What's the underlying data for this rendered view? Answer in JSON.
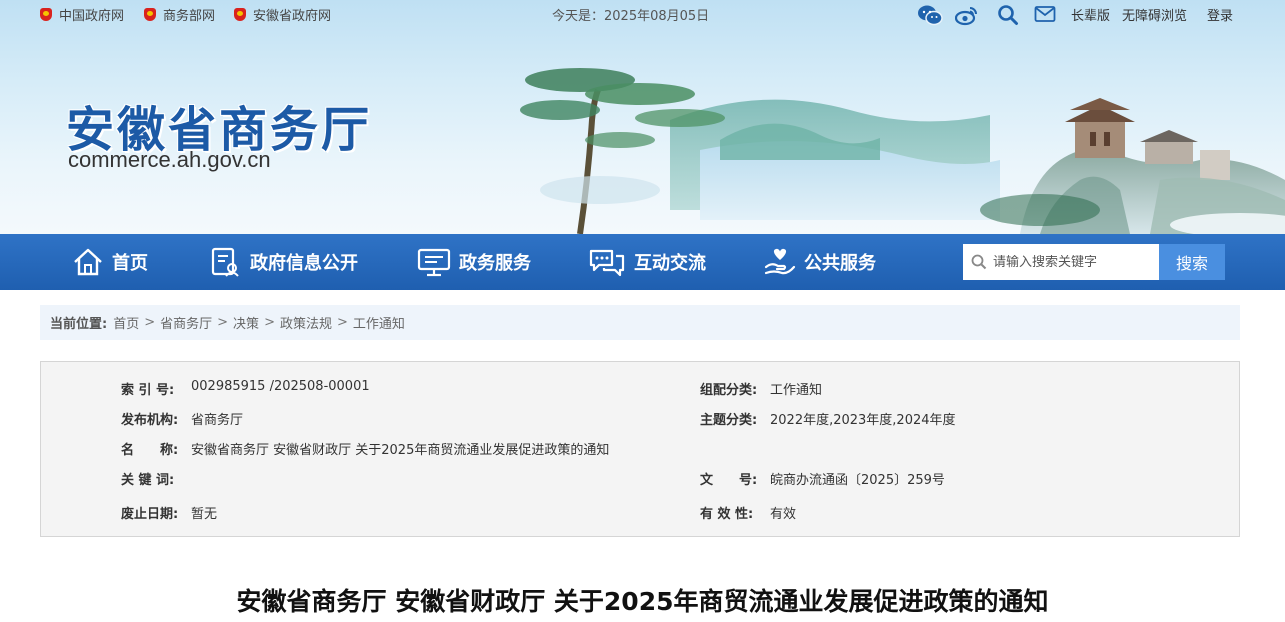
{
  "topbar": {
    "links": [
      "中国政府网",
      "商务部网",
      "安徽省政府网"
    ],
    "date": "今天是：2025年08月05日",
    "icons": [
      "wechat-icon",
      "weibo-icon",
      "search-icon",
      "mail-icon"
    ],
    "elder_mode": "长辈版",
    "accessibility": "无障碍浏览",
    "login": "登录"
  },
  "header": {
    "title": "安徽省商务厅",
    "domain": "commerce.ah.gov.cn"
  },
  "nav": {
    "items": [
      {
        "label": "首页",
        "icon": "home-icon"
      },
      {
        "label": "政府信息公开",
        "icon": "document-icon"
      },
      {
        "label": "政务服务",
        "icon": "monitor-icon"
      },
      {
        "label": "互动交流",
        "icon": "chat-icon"
      },
      {
        "label": "公共服务",
        "icon": "hand-heart-icon"
      }
    ],
    "search_placeholder": "请输入搜索关键字",
    "search_button": "搜索"
  },
  "breadcrumb": {
    "label": "当前位置:",
    "items": [
      "首页",
      "省商务厅",
      "决策",
      "政策法规",
      "工作通知"
    ]
  },
  "info": {
    "index_key": "索 引 号:",
    "index_val": "002985915 /202508-00001",
    "category_key": "组配分类:",
    "category_val": "工作通知",
    "publisher_key": "发布机构:",
    "publisher_val": "省商务厅",
    "subject_key": "主题分类:",
    "subject_val": "2022年度,2023年度,2024年度",
    "name_key": "名　　称:",
    "name_val": "安徽省商务厅 安徽省财政厅 关于2025年商贸流通业发展促进政策的通知",
    "keywords_key": "关 键 词:",
    "keywords_val": "",
    "docno_key": "文　　号:",
    "docno_val": "皖商办流通函〔2025〕259号",
    "expiry_key": "废止日期:",
    "expiry_val": "暂无",
    "validity_key": "有 效 性:",
    "validity_val": "有效"
  },
  "document": {
    "title": "安徽省商务厅 安徽省财政厅 关于2025年商贸流通业发展促进政策的通知"
  },
  "colors": {
    "brand_blue": "#1c5aa6",
    "nav_blue": "#2366b8",
    "search_button": "#4a8fe0"
  }
}
